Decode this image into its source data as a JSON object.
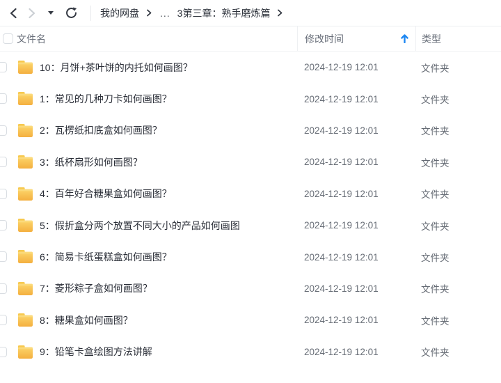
{
  "toolbar": {
    "icons": {
      "back": "chevron-left-icon",
      "forward": "chevron-right-icon",
      "history": "caret-down-icon",
      "refresh": "refresh-icon"
    },
    "breadcrumb": {
      "root": "我的网盘",
      "collapsed": "...",
      "current": "3第三章：熟手磨炼篇"
    }
  },
  "table": {
    "header": {
      "name": "文件名",
      "modified": "修改时间",
      "type": "类型",
      "sort_icon": "arrow-up-icon"
    },
    "rows": [
      {
        "name": "10：月饼+茶叶饼的内托如何画图？",
        "modified": "2024-12-19 12:01",
        "type": "文件夹"
      },
      {
        "name": "1：常见的几种刀卡如何画图？",
        "modified": "2024-12-19 12:01",
        "type": "文件夹"
      },
      {
        "name": "2：瓦楞纸扣底盒如何画图？",
        "modified": "2024-12-19 12:01",
        "type": "文件夹"
      },
      {
        "name": "3：纸杯扇形如何画图？",
        "modified": "2024-12-19 12:01",
        "type": "文件夹"
      },
      {
        "name": "4：百年好合糖果盒如何画图？",
        "modified": "2024-12-19 12:01",
        "type": "文件夹"
      },
      {
        "name": "5：假折盒分两个放置不同大小的产品如何画图",
        "modified": "2024-12-19 12:01",
        "type": "文件夹"
      },
      {
        "name": "6：简易卡纸蛋糕盒如何画图？",
        "modified": "2024-12-19 12:01",
        "type": "文件夹"
      },
      {
        "name": "7：菱形粽子盒如何画图？",
        "modified": "2024-12-19 12:01",
        "type": "文件夹"
      },
      {
        "name": "8：糖果盒如何画图？",
        "modified": "2024-12-19 12:01",
        "type": "文件夹"
      },
      {
        "name": "9：铅笔卡盒绘图方法讲解",
        "modified": "2024-12-19 12:01",
        "type": "文件夹"
      }
    ]
  },
  "colors": {
    "sort_arrow_blue": "#1d87f2",
    "folder_yellow_top": "#FCD66B",
    "folder_yellow_bottom": "#F4AF3F",
    "folder_tab": "#F7C94F",
    "text_dark": "#2b2f38",
    "text_gray": "#666c75"
  }
}
